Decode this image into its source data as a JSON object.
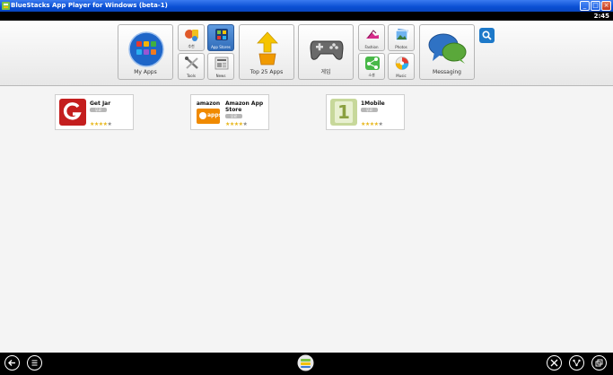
{
  "titlebar": {
    "title": "BlueStacks App Player for Windows (beta-1)",
    "minimize": "_",
    "maximize": "□",
    "close": "×"
  },
  "statusbar": {
    "time": "2:45"
  },
  "launcher": {
    "my_apps": "My Apps",
    "small_left": [
      {
        "label": "추천"
      },
      {
        "label": "App Stores"
      },
      {
        "label": "Tools"
      },
      {
        "label": "News"
      }
    ],
    "top25": "Top 25 Apps",
    "games": "게임",
    "small_right": [
      {
        "label": "Fashion"
      },
      {
        "label": "Photos"
      },
      {
        "label": "소셜"
      },
      {
        "label": "Music"
      }
    ],
    "messaging": "Messaging"
  },
  "apps": [
    {
      "name": "Get Jar",
      "badge": "무료",
      "stars": "★★★★",
      "star_off": "★"
    },
    {
      "name": "Amazon App Store",
      "badge": "무료",
      "stars": "★★★★",
      "star_off": "★",
      "icon_text": "amazon",
      "icon_sub": "apps"
    },
    {
      "name": "1Mobile",
      "badge": "무료",
      "stars": "★★★★",
      "star_off": "★",
      "icon_text": "1"
    }
  ],
  "colors": {
    "accent": "#1d79c9",
    "titlebar": "#0a4fd3",
    "star": "#e8b71c"
  }
}
